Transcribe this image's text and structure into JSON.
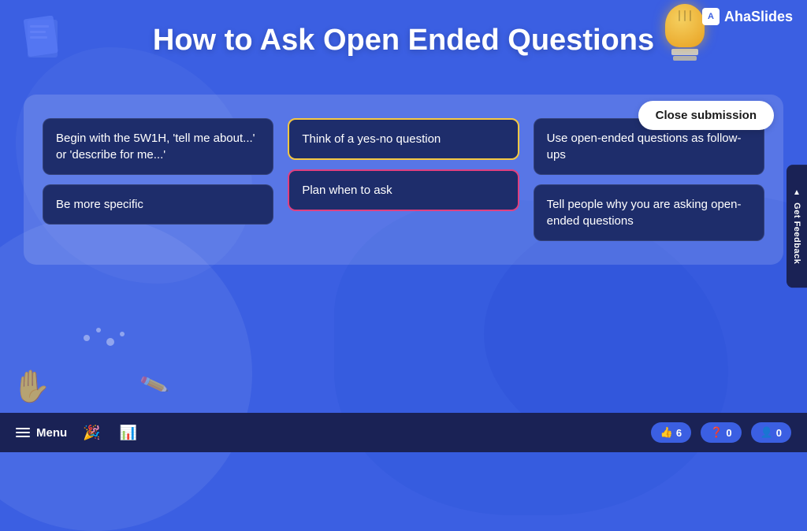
{
  "brand": {
    "logo_label": "A",
    "name": "AhaSlides"
  },
  "header": {
    "title": "How to Ask Open Ended Questions"
  },
  "close_button": {
    "label": "Close submission"
  },
  "feedback_tab": {
    "label": "Get Feedback"
  },
  "cards": {
    "column1": [
      {
        "text": "Begin with the 5W1H, 'tell me about...' or 'describe for me...'",
        "highlight": "none"
      },
      {
        "text": "Be more specific",
        "highlight": "none"
      }
    ],
    "column2": [
      {
        "text": "Think of a yes-no question",
        "highlight": "yellow"
      },
      {
        "text": "Plan when to ask",
        "highlight": "pink"
      }
    ],
    "column3": [
      {
        "text": "Use open-ended questions as follow-ups",
        "highlight": "none"
      },
      {
        "text": "Tell people why you are asking open-ended questions",
        "highlight": "none"
      }
    ]
  },
  "bottom_bar": {
    "menu_label": "Menu",
    "stats": {
      "thumbs": "6",
      "questions": "0",
      "users": "0"
    }
  }
}
